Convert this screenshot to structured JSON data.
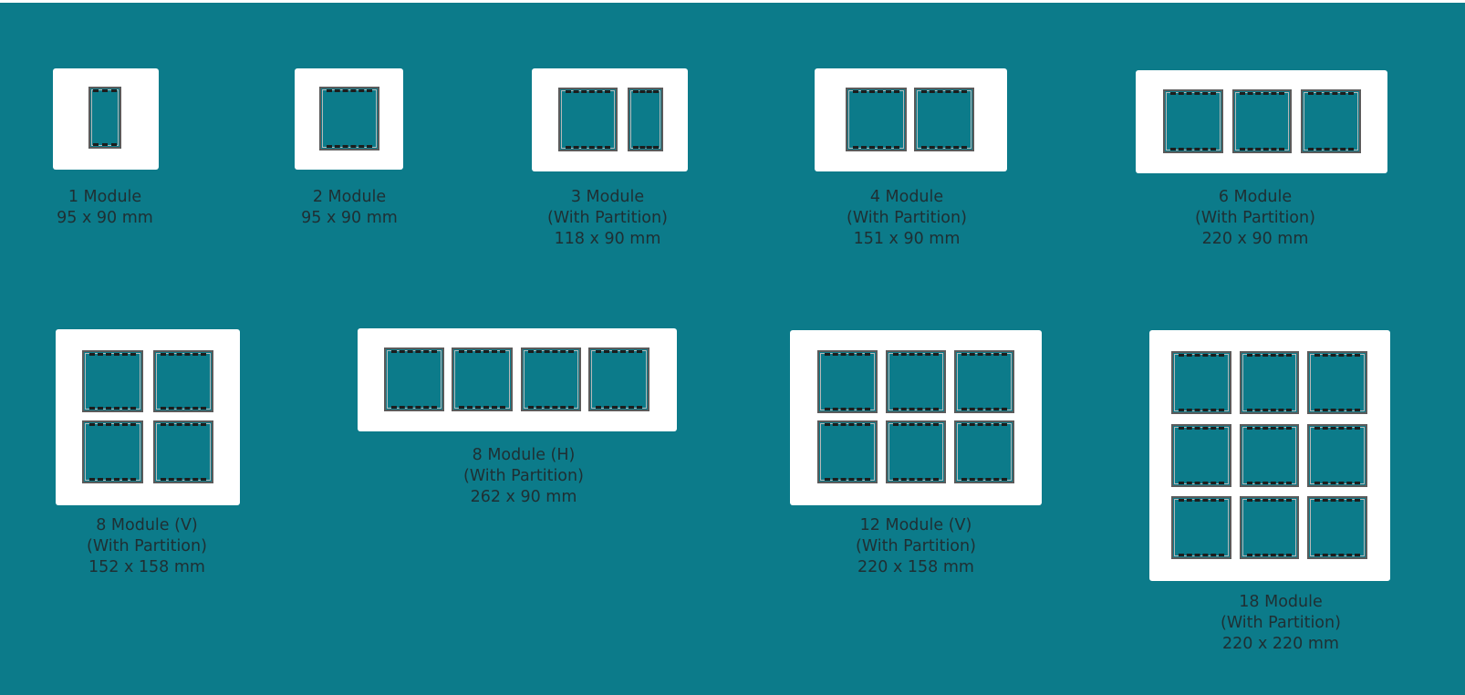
{
  "background_color": "#0c7b8a",
  "plate_color": "#ffffff",
  "frame_color": "#5b5b5b",
  "plates": [
    {
      "id": "1-module",
      "rows": 1,
      "cols": 1,
      "lines": [
        "1 Module",
        "95 x 90 mm"
      ]
    },
    {
      "id": "2-module",
      "rows": 1,
      "cols": 1,
      "lines": [
        "2 Module",
        "95 x 90 mm"
      ]
    },
    {
      "id": "3-module",
      "rows": 1,
      "cols": 2,
      "lines": [
        "3 Module",
        "(With Partition)",
        "118 x 90 mm"
      ]
    },
    {
      "id": "4-module",
      "rows": 1,
      "cols": 2,
      "lines": [
        "4 Module",
        "(With Partition)",
        "151 x 90 mm"
      ]
    },
    {
      "id": "6-module",
      "rows": 1,
      "cols": 3,
      "lines": [
        "6 Module",
        "(With Partition)",
        "220 x 90 mm"
      ]
    },
    {
      "id": "8-module-v",
      "rows": 2,
      "cols": 2,
      "lines": [
        "8 Module (V)",
        "(With Partition)",
        "152 x 158 mm"
      ]
    },
    {
      "id": "8-module-h",
      "rows": 1,
      "cols": 4,
      "lines": [
        "8 Module (H)",
        "(With Partition)",
        "262 x 90 mm"
      ]
    },
    {
      "id": "12-module-v",
      "rows": 2,
      "cols": 3,
      "lines": [
        "12 Module (V)",
        "(With Partition)",
        "220 x 158 mm"
      ]
    },
    {
      "id": "18-module",
      "rows": 3,
      "cols": 3,
      "lines": [
        "18 Module",
        "(With Partition)",
        "220 x 220 mm"
      ]
    }
  ]
}
